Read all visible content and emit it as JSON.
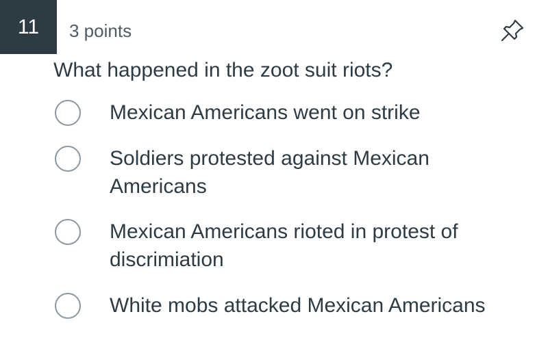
{
  "question": {
    "number": "11",
    "points": "3 points",
    "text": "What happened in the zoot suit riots?",
    "pin_icon": "pin-icon"
  },
  "answers": [
    {
      "label": "Mexican Americans went on strike"
    },
    {
      "label": "Soldiers protested against Mexican Americans"
    },
    {
      "label": "Mexican Americans rioted in protest of discrimiation"
    },
    {
      "label": "White mobs attacked Mexican Americans"
    }
  ]
}
